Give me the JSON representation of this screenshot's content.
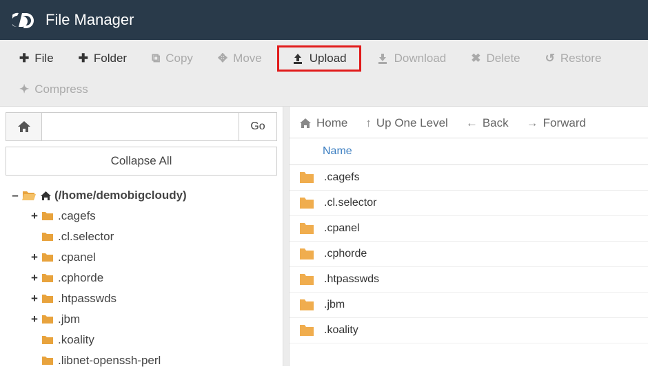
{
  "header": {
    "title": "File Manager"
  },
  "toolbar": {
    "file": "File",
    "folder": "Folder",
    "copy": "Copy",
    "move": "Move",
    "upload": "Upload",
    "download": "Download",
    "delete": "Delete",
    "restore": "Restore",
    "compress": "Compress"
  },
  "left": {
    "go": "Go",
    "path_value": "",
    "collapse": "Collapse All",
    "tree": {
      "root": "(/home/demobigcloudy)",
      "items": [
        {
          "expandable": true,
          "label": ".cagefs"
        },
        {
          "expandable": false,
          "label": ".cl.selector"
        },
        {
          "expandable": true,
          "label": ".cpanel"
        },
        {
          "expandable": true,
          "label": ".cphorde"
        },
        {
          "expandable": true,
          "label": ".htpasswds"
        },
        {
          "expandable": true,
          "label": ".jbm"
        },
        {
          "expandable": false,
          "label": ".koality"
        },
        {
          "expandable": false,
          "label": ".libnet-openssh-perl"
        }
      ]
    }
  },
  "nav": {
    "home": "Home",
    "up": "Up One Level",
    "back": "Back",
    "forward": "Forward"
  },
  "table": {
    "col_name": "Name",
    "rows": [
      ".cagefs",
      ".cl.selector",
      ".cpanel",
      ".cphorde",
      ".htpasswds",
      ".jbm",
      ".koality"
    ]
  }
}
